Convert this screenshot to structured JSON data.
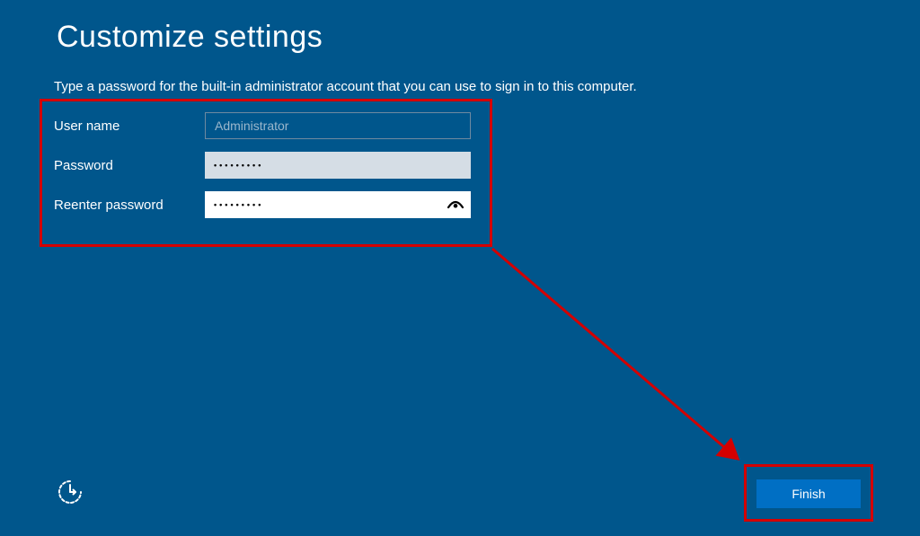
{
  "title": "Customize settings",
  "subtitle": "Type a password for the built-in administrator account that you can use to sign in to this computer.",
  "form": {
    "username_label": "User name",
    "username_value": "Administrator",
    "password_label": "Password",
    "password_value": "•••••••••",
    "reenter_label": "Reenter password",
    "reenter_value": "•••••••••"
  },
  "buttons": {
    "finish": "Finish"
  },
  "colors": {
    "background": "#00568c",
    "accent": "#006fc4",
    "highlight": "#d40000"
  }
}
